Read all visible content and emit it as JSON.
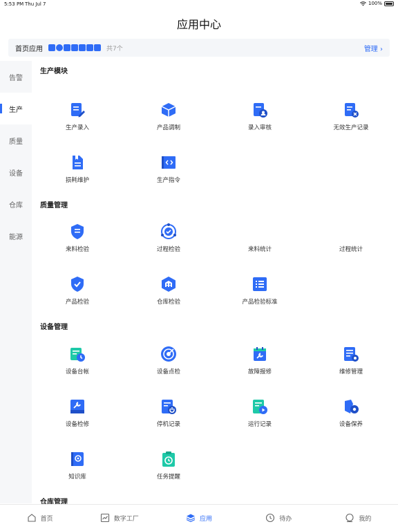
{
  "status": {
    "time": "5:53 PM",
    "date": "Thu Jul 7",
    "battery": "100%"
  },
  "page_title": "应用中心",
  "home_apps": {
    "label": "首页应用",
    "count": "共7个",
    "manage": "管理 ›"
  },
  "sidebar": [
    "告警",
    "生产",
    "质量",
    "设备",
    "仓库",
    "能源"
  ],
  "sections": {
    "production": {
      "title": "生产模块",
      "apps": [
        "生产录入",
        "产品调制",
        "录入审核",
        "无效生产记录",
        "损耗维护",
        "生产指令"
      ]
    },
    "quality": {
      "title": "质量管理",
      "apps": [
        "来料检验",
        "过程检验",
        "来料统计",
        "过程统计",
        "产品检验",
        "仓库检验",
        "产品检验标准"
      ]
    },
    "equipment": {
      "title": "设备管理",
      "apps": [
        "设备台帐",
        "设备点检",
        "故障报修",
        "维修管理",
        "设备检修",
        "停机记录",
        "运行记录",
        "设备保养",
        "知识库",
        "任务提醒"
      ]
    },
    "warehouse": {
      "title": "仓库管理"
    }
  },
  "tabbar": [
    "首页",
    "数字工厂",
    "应用",
    "待办",
    "我的"
  ],
  "colors": {
    "accent": "#2f6cf6",
    "teal": "#1ec9a8"
  }
}
